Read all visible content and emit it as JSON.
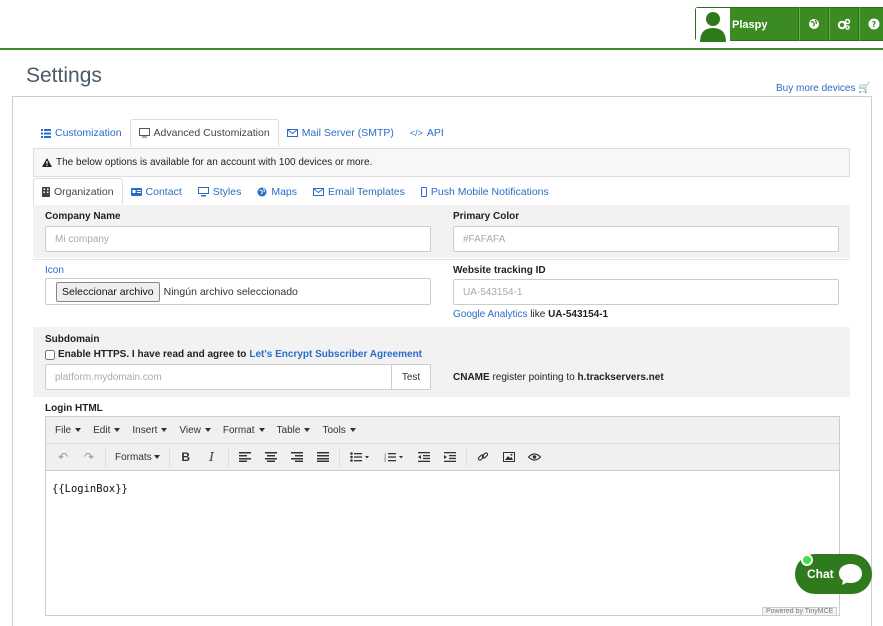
{
  "header": {
    "user_name": "Plaspy",
    "icons": [
      "user-avatar-icon",
      "globe-icon",
      "cogs-icon",
      "help-icon"
    ]
  },
  "page": {
    "title": "Settings",
    "buy_more": "Buy more devices"
  },
  "main_tabs": [
    {
      "label": "Customization",
      "icon": "list-icon"
    },
    {
      "label": "Advanced Customization",
      "icon": "monitor-icon",
      "active": true
    },
    {
      "label": "Mail Server (SMTP)",
      "icon": "envelope-icon"
    },
    {
      "label": "API",
      "icon": "code-icon"
    }
  ],
  "notice": "The below options is available for an account with 100 devices or more.",
  "sub_tabs": [
    {
      "label": "Organization",
      "icon": "building-icon",
      "active": true
    },
    {
      "label": "Contact",
      "icon": "id-card-icon"
    },
    {
      "label": "Styles",
      "icon": "desktop-icon"
    },
    {
      "label": "Maps",
      "icon": "globe-icon"
    },
    {
      "label": "Email Templates",
      "icon": "envelope-icon"
    },
    {
      "label": "Push Mobile Notifications",
      "icon": "mobile-icon"
    }
  ],
  "form": {
    "company_name_label": "Company Name",
    "company_name_placeholder": "Mi company",
    "primary_color_label": "Primary Color",
    "primary_color_placeholder": "#FAFAFA",
    "icon_label": "Icon",
    "file_button": "Seleccionar archivo",
    "file_status": "Ningún archivo seleccionado",
    "tracking_label": "Website tracking ID",
    "tracking_placeholder": "UA-543154-1",
    "tracking_help_link": "Google Analytics",
    "tracking_help_like": "like",
    "tracking_help_example": "UA-543154-1",
    "subdomain_label": "Subdomain",
    "https_text": "Enable HTTPS. I have read and agree to",
    "https_link": "Let's Encrypt Subscriber Agreement",
    "subdomain_placeholder": "platform.mydomain.com",
    "test_button": "Test",
    "cname_prefix": "CNAME",
    "cname_text": "register pointing to",
    "cname_host": "h.trackservers.net",
    "login_html_label": "Login HTML"
  },
  "editor": {
    "menus": [
      "File",
      "Edit",
      "Insert",
      "View",
      "Format",
      "Table",
      "Tools"
    ],
    "formats_label": "Formats",
    "content": "{{LoginBox}}",
    "powered": "Powered by TinyMCE"
  },
  "chat": {
    "label": "Chat"
  },
  "colors": {
    "brand_green": "#3c8a22",
    "link_blue": "#2a6cc9"
  }
}
